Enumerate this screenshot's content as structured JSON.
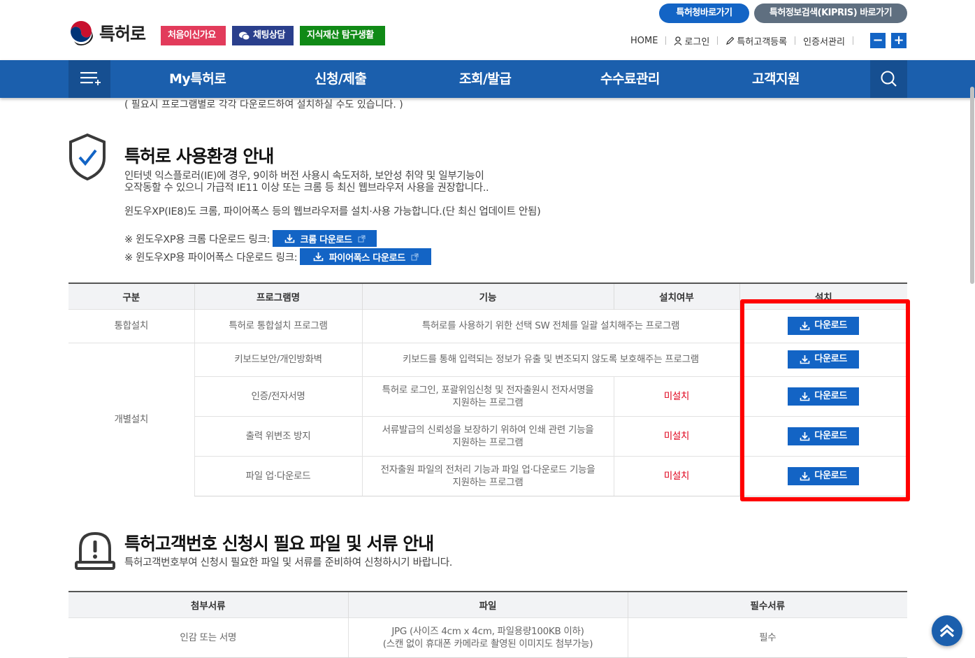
{
  "header": {
    "logo_text": "특허로",
    "quick_buttons": [
      "처음이신가요",
      "채팅상담",
      "지식재산 탐구생활"
    ],
    "external_links": [
      "특허청바로가기",
      "특허정보검색(KIPRIS) 바로가기"
    ],
    "util_links": [
      "HOME",
      "로그인",
      "특허고객등록",
      "인증서관리"
    ],
    "zoom_out": "−",
    "zoom_in": "+"
  },
  "nav": {
    "items": [
      "My특허로",
      "신청/제출",
      "조회/발급",
      "수수료관리",
      "고객지원"
    ]
  },
  "top_note": "( 필요시 프로그램별로 각각 다운로드하여 설치하실 수도 있습니다. )",
  "env_section": {
    "title": "특허로 사용환경 안내",
    "para1_line1": "인터넷 익스플로러(IE)에 경우, 9이하 버전 사용시 속도저하, 보안성 취약 및 일부기능이",
    "para1_line2": "오작동할 수 있으니 가급적 IE11 이상 또는 크롬 등 최신 웹브라우저 사용을 권장합니다..",
    "para2": "윈도우XP(IE8)도 크롬, 파이어폭스 등의 웹브라우저를 설치·사용 가능합니다.(단 최신 업데이트 안됨)",
    "chrome_label": "※ 윈도우XP용 크롬 다운로드 링크:",
    "chrome_button": "크롬 다운로드",
    "firefox_label": "※ 윈도우XP용 파이어폭스 다운로드 링크:",
    "firefox_button": "파이어폭스 다운로드"
  },
  "install_table": {
    "headers": [
      "구분",
      "프로그램명",
      "기능",
      "설치여부",
      "설치"
    ],
    "group1": "통합설치",
    "group2": "개별설치",
    "rows": [
      {
        "name": "특허로 통합설치 프로그램",
        "func1": "특허로를 사용하기 위한 선택 SW 전체를 일괄 설치해주는 프로그램",
        "func2": "",
        "status": "",
        "button": "다운로드"
      },
      {
        "name": "키보드보안/개인방화벽",
        "func1": "키보드를 통해 입력되는 정보가 유출 및 변조되지 않도록 보호해주는 프로그램",
        "func2": "",
        "status": "",
        "button": "다운로드"
      },
      {
        "name": "인증/전자서명",
        "func1": "특허로 로그인, 포괄위임신청 및 전자출원시 전자서명을",
        "func2": "지원하는 프로그램",
        "status": "미설치",
        "button": "다운로드"
      },
      {
        "name": "출력 위변조 방지",
        "func1": "서류발급의 신뢰성을 보장하기 위하여 인쇄 관련 기능을",
        "func2": "지원하는 프로그램",
        "status": "미설치",
        "button": "다운로드"
      },
      {
        "name": "파일 업·다운로드",
        "func1": "전자출원 파일의 전처리 기능과 파일 업·다운로드 기능을",
        "func2": "지원하는 프로그램",
        "status": "미설치",
        "button": "다운로드"
      }
    ]
  },
  "customer_section": {
    "title": "특허고객번호 신청시 필요 파일 및 서류 안내",
    "desc": "특허고객번호부여 신청시 필요한 파일 및 서류를 준비하여 신청하시기 바랍니다."
  },
  "doc_table": {
    "headers": [
      "첨부서류",
      "파일",
      "필수서류"
    ],
    "rows": [
      {
        "doc": "인감 또는 서명",
        "file1": "JPG (사이즈 4cm x 4cm, 파일용량100KB 이하)",
        "file2": "(스캔 없이 휴대폰 카메라로 촬영된 이미지도 첨부가능)",
        "required": "필수"
      }
    ]
  },
  "colors": {
    "nav_blue": "#1b5fad",
    "button_blue": "#1364c5",
    "highlight_red": "#ff0000",
    "missing_red": "#e0001a"
  }
}
